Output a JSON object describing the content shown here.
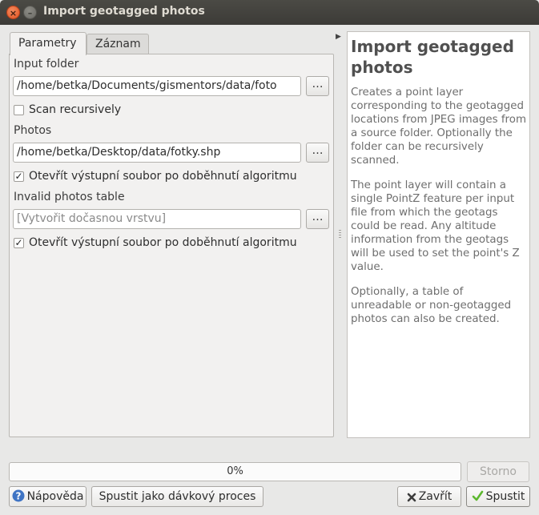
{
  "window": {
    "title": "Import geotagged photos",
    "close_glyph": "×",
    "min_glyph": "–"
  },
  "tabs": [
    {
      "label": "Parametry"
    },
    {
      "label": "Záznam"
    }
  ],
  "params": {
    "input_folder": {
      "label": "Input folder",
      "value": "/home/betka/Documents/gismentors/data/foto"
    },
    "scan_recursively": {
      "label": "Scan recursively",
      "checked": false
    },
    "photos": {
      "label": "Photos",
      "value": "/home/betka/Desktop/data/fotky.shp"
    },
    "open_output_1": {
      "label": "Otevřít výstupní soubor po doběhnutí algoritmu",
      "checked": true
    },
    "invalid_table": {
      "label": "Invalid photos table",
      "placeholder": "[Vytvořit dočasnou vrstvu]"
    },
    "open_output_2": {
      "label": "Otevřít výstupní soubor po doběhnutí algoritmu",
      "checked": true
    },
    "browse_label": "…",
    "check_glyph": "✓"
  },
  "help": {
    "title": "Import geotagged photos",
    "paragraphs": [
      "Creates a point layer corresponding to the geotagged locations from JPEG images from a source folder. Optionally the folder can be recursively scanned.",
      "The point layer will contain a single PointZ feature per input file from which the geotags could be read. Any altitude information from the geotags will be used to set the point's Z value.",
      "Optionally, a table of unreadable or non-geotagged photos can also be created."
    ]
  },
  "progress": {
    "text": "0%",
    "value": 0
  },
  "buttons": {
    "cancel": "Storno",
    "help": "Nápověda",
    "batch": "Spustit jako dávkový proces",
    "close": "Zavřít",
    "run": "Spustit"
  },
  "icons": {
    "help": "help-circle-icon",
    "close": "x-icon",
    "run": "checkmark-icon",
    "collapse": "arrow-right-icon"
  },
  "colors": {
    "help_icon": "#3f74c4",
    "run_icon": "#5cb82e",
    "close_icon": "#3c3c3c",
    "titlebar": "#3c3b37"
  }
}
